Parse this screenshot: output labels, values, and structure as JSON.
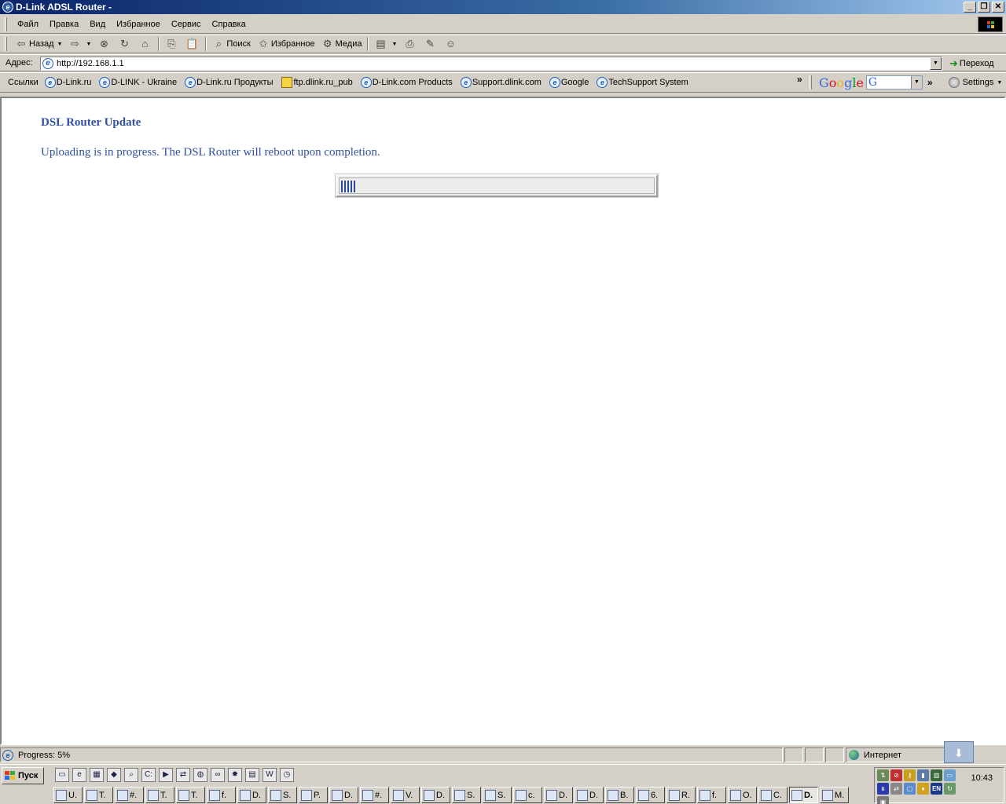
{
  "window": {
    "title": "D-Link ADSL Router -"
  },
  "menu": [
    "Файл",
    "Правка",
    "Вид",
    "Избранное",
    "Сервис",
    "Справка"
  ],
  "toolbar": {
    "back": "Назад",
    "search": "Поиск",
    "favorites": "Избранное",
    "media": "Медиа"
  },
  "address": {
    "label": "Адрес:",
    "value": "http://192.168.1.1",
    "go": "Переход"
  },
  "links": {
    "label": "Ссылки",
    "items": [
      "D-Link.ru",
      "D-LINK - Ukraine",
      "D-Link.ru Продукты",
      "ftp.dlink.ru_pub",
      "D-Link.com Products",
      "Support.dlink.com",
      "Google",
      "TechSupport System"
    ],
    "settings": "Settings"
  },
  "page": {
    "title": "DSL Router Update",
    "message": "Uploading is in progress. The DSL Router will reboot upon completion.",
    "progress_fraction": 0.05
  },
  "status": {
    "text": "Progress: 5%",
    "zone": "Интернет"
  },
  "taskbar": {
    "start": "Пуск",
    "tasks": [
      {
        "label": "U."
      },
      {
        "label": "T."
      },
      {
        "label": "#."
      },
      {
        "label": "T."
      },
      {
        "label": "T."
      },
      {
        "label": "f."
      },
      {
        "label": "D."
      },
      {
        "label": "S."
      },
      {
        "label": "P."
      },
      {
        "label": "D."
      },
      {
        "label": "#."
      },
      {
        "label": "V."
      },
      {
        "label": "D."
      },
      {
        "label": "S."
      },
      {
        "label": "S."
      },
      {
        "label": "c."
      },
      {
        "label": "D."
      },
      {
        "label": "D."
      },
      {
        "label": "B."
      },
      {
        "label": "6."
      },
      {
        "label": "R."
      },
      {
        "label": "f."
      },
      {
        "label": "O."
      },
      {
        "label": "C."
      },
      {
        "label": "D.",
        "active": true
      },
      {
        "label": "M."
      }
    ],
    "tray_lang": "EN",
    "clock": "10:43"
  }
}
